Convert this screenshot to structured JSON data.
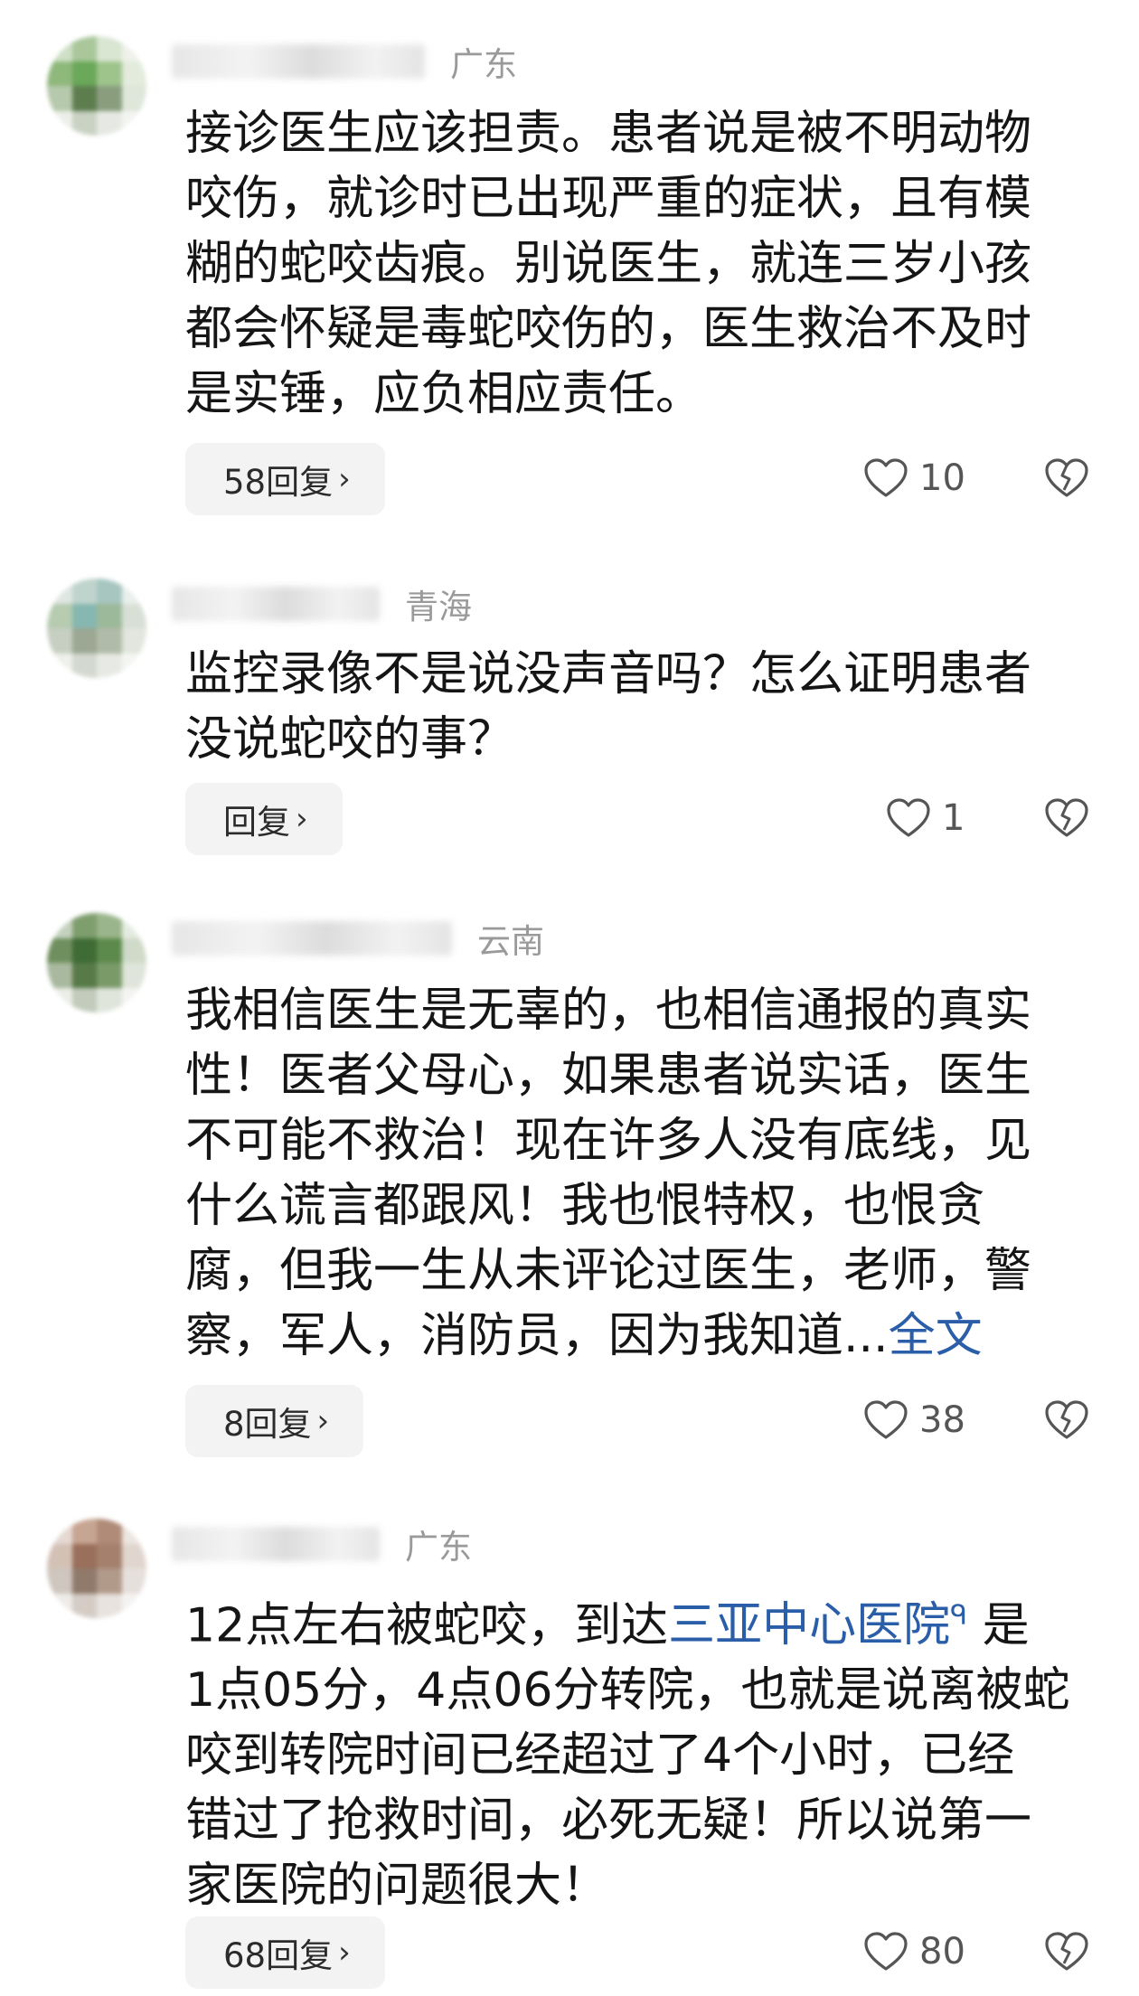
{
  "comments": [
    {
      "location": "广东",
      "text": "接诊医生应该担责。患者说是被不明动物\n咬伤，就诊时已出现严重的症状，且有模\n糊的蛇咬齿痕。别说医生，就连三岁小孩\n都会怀疑是毒蛇咬伤的，医生救治不及时\n是实锤，应负相应责任。",
      "reply_label": "58回复",
      "likes": "10"
    },
    {
      "location": "青海",
      "text": "监控录像不是说没声音吗？怎么证明患者\n没说蛇咬的事？",
      "reply_label": "回复",
      "likes": "1"
    },
    {
      "location": "云南",
      "text": "我相信医生是无辜的，也相信通报的真实\n性！医者父母心，如果患者说实话，医生\n不可能不救治！现在许多人没有底线，见\n什么谎言都跟风！我也恨特权，也恨贪\n腐，但我一生从未评论过医生，老师，警\n察，军人，消防员，因为我知道...",
      "more_label": "全文",
      "reply_label": "8回复",
      "likes": "38"
    },
    {
      "location": "广东",
      "text_before": "12点左右被蛇咬，到达",
      "hospital_link": "三亚中心医院",
      "text_after": " 是\n1点05分，4点06分转院，也就是说离被蛇\n咬到转院时间已经超过了4个小时，已经\n错过了抢救时间，必死无疑！所以说第一\n家医院的问题很大！",
      "reply_label": "68回复",
      "likes": "80"
    }
  ],
  "icons": {
    "reply_chevron": "chevron-right-icon",
    "like": "heart-outline-icon",
    "dislike": "broken-heart-icon",
    "link_search": "magnifier-icon"
  },
  "colors": {
    "link": "#2a5ea8",
    "location": "#9a9a9a",
    "reply_bg": "#f3f3f3"
  }
}
